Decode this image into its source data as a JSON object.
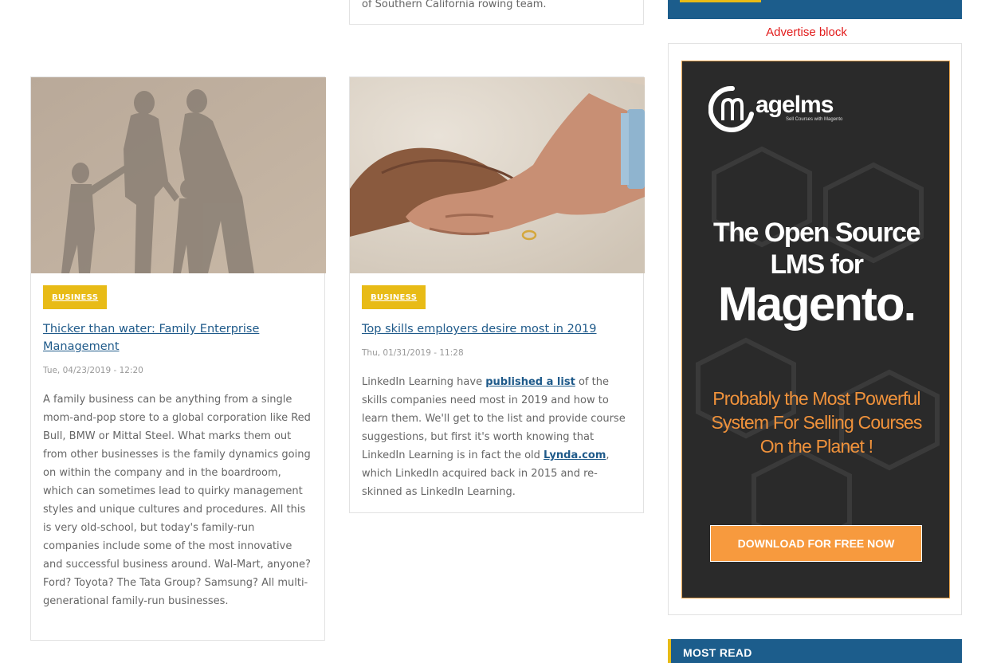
{
  "top_card": {
    "excerpt_tail": "of Southern California rowing team."
  },
  "articles": [
    {
      "category": "BUSINESS",
      "title": "Thicker than water: Family Enterprise Management",
      "date": "Tue, 04/23/2019 - 12:20",
      "body": "A family business can be anything from a single mom-and-pop store to a global corporation like Red Bull, BMW or Mittal Steel. What marks them out from other businesses is the family dynamics going on within the company and in the boardroom, which can sometimes lead to quirky management styles and unique cultures and procedures. All this is very old-school, but today's family-run companies include some of the most innovative and successful business around. Wal-Mart, anyone? Ford? Toyota? The Tata Group? Samsung? All multi-generational family-run businesses."
    },
    {
      "category": "BUSINESS",
      "title": "Top skills employers desire most in 2019",
      "date": "Thu, 01/31/2019 - 11:28",
      "body_part1": "LinkedIn Learning have ",
      "body_link1": "published a list",
      "body_part2": " of the skills companies need most in 2019 and how to learn them. We'll get to the list and provide course suggestions, but first it's worth knowing that LinkedIn Learning is in fact the old ",
      "body_link2": "Lynda.com",
      "body_part3": ", which LinkedIn acquired back in 2015 and re-skinned as LinkedIn Learning."
    }
  ],
  "sidebar": {
    "advertise_label": "Advertise block",
    "ad": {
      "logo": "agelms",
      "logo_sub": "Sell Courses with Magento",
      "headline_1": "The Open Source",
      "headline_2": "LMS for",
      "headline_3": "Magento.",
      "tagline_1": "Probably the Most Powerful",
      "tagline_2": "System For Selling  Courses",
      "tagline_3": "On the Planet !",
      "button": "DOWNLOAD FOR FREE NOW"
    },
    "most_read_title": "MOST READ"
  },
  "colors": {
    "accent": "#e8bb16",
    "brand_blue": "#1c5d8c",
    "link": "#1f5a8a",
    "ad_orange": "#f79a3e"
  }
}
